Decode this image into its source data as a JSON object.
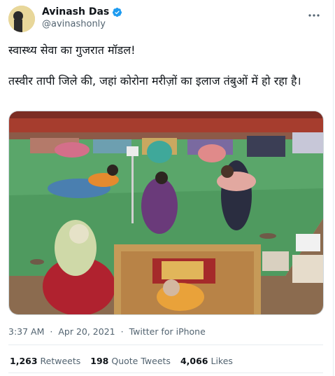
{
  "author": {
    "name": "Avinash Das",
    "handle": "@avinashonly",
    "verified": true
  },
  "tweet": {
    "line1": "स्वास्थ्य सेवा का गुजरात मॉडल!",
    "line2": "तस्वीर तापी जिले की, जहां कोरोना मरीज़ों का इलाज तंबुओं में हो रहा है।"
  },
  "meta": {
    "time": "3:37 AM",
    "separator1": "·",
    "date": "Apr 20, 2021",
    "separator2": "·",
    "source": "Twitter for iPhone"
  },
  "stats": {
    "retweets_count": "1,263",
    "retweets_label": "Retweets",
    "quotes_count": "198",
    "quotes_label": "Quote Tweets",
    "likes_count": "4,066",
    "likes_label": "Likes"
  },
  "icons": {
    "more": "more-options-icon",
    "verified": "verified-badge-icon"
  },
  "colors": {
    "verified_blue": "#1d9bf0",
    "secondary_text": "#536471"
  }
}
